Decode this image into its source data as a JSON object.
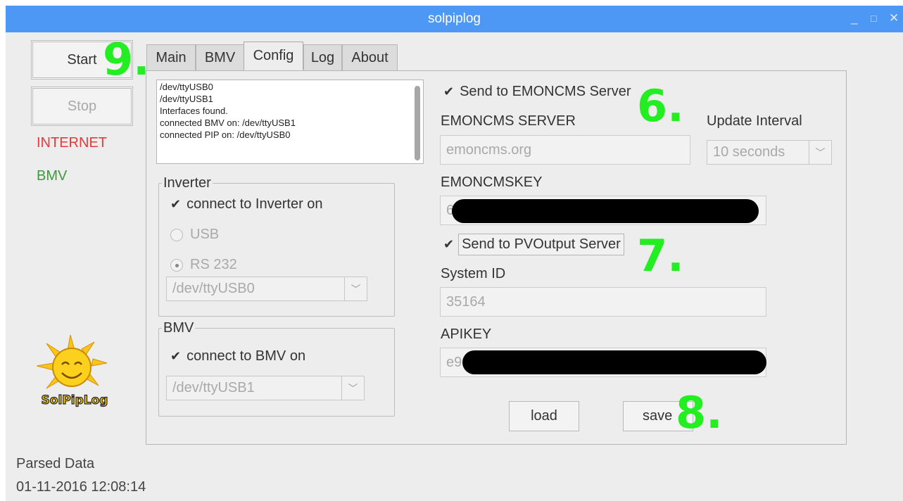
{
  "window": {
    "title": "solpiplog",
    "minimize": "_",
    "maximize": "□",
    "close": "✕"
  },
  "sidebar": {
    "start_label": "Start",
    "stop_label": "Stop",
    "internet_label": "INTERNET",
    "bmv_label": "BMV",
    "logo_text": "SolPipLog"
  },
  "tabs": [
    {
      "label": "Main"
    },
    {
      "label": "BMV"
    },
    {
      "label": "Config"
    },
    {
      "label": "Log"
    },
    {
      "label": "About"
    }
  ],
  "log_lines": [
    "/dev/ttyUSB0",
    "/dev/ttyUSB1",
    "Interfaces found.",
    "connected BMV on: /dev/ttyUSB1",
    "connected PIP on: /dev/ttyUSB0"
  ],
  "inverter": {
    "legend": "Inverter",
    "connect_label": "connect to Inverter on",
    "usb_label": "USB",
    "rs232_label": "RS 232",
    "port": "/dev/ttyUSB0"
  },
  "bmv": {
    "legend": "BMV",
    "connect_label": "connect to BMV on",
    "port": "/dev/ttyUSB1"
  },
  "emoncms": {
    "send_label": "Send to EMONCMS Server",
    "server_label": "EMONCMS SERVER",
    "server_value": "emoncms.org",
    "interval_label": "Update Interval",
    "interval_value": "10 seconds",
    "key_label": "EMONCMSKEY",
    "key_value": "6"
  },
  "pvoutput": {
    "send_label": "Send to PVOutput Server",
    "system_id_label": "System ID",
    "system_id_value": "35164",
    "apikey_label": "APIKEY",
    "apikey_value": "e9"
  },
  "actions": {
    "load_label": "load",
    "save_label": "save"
  },
  "footer": {
    "parsed_label": "Parsed Data",
    "timestamp": "01-11-2016 12:08:14"
  },
  "annotations": {
    "a6": "6.",
    "a7": "7.",
    "a8": "8.",
    "a9": "9."
  },
  "colors": {
    "titlebar": "#4d98f5",
    "internet": "#e23b3b",
    "bmv": "#3c9a3c",
    "annotation": "#22ee22"
  },
  "icons": {
    "checkbox": "checkmark-icon",
    "dropdown": "chevron-down-icon",
    "logo": "sun-logo-icon"
  }
}
